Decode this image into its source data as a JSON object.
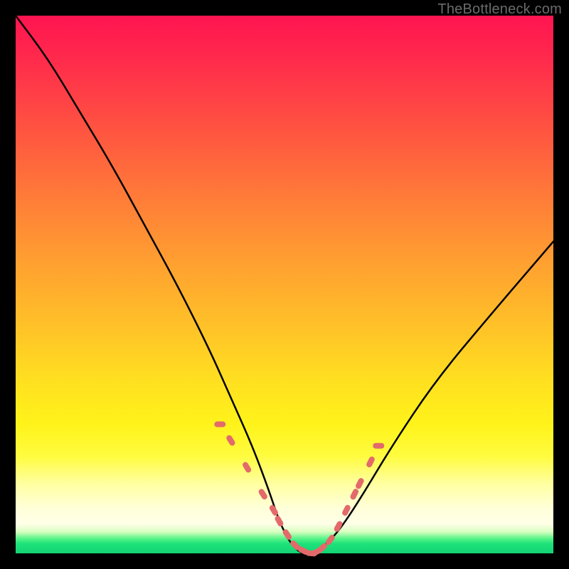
{
  "watermark": "TheBottleneck.com",
  "colors": {
    "frame": "#000000",
    "curve": "#000000",
    "marker": "#e36a6a",
    "gradient_top": "#ff1450",
    "gradient_mid": "#ffe020",
    "gradient_green": "#1de27a"
  },
  "chart_data": {
    "type": "line",
    "title": "",
    "xlabel": "",
    "ylabel": "",
    "xlim": [
      0,
      100
    ],
    "ylim": [
      0,
      100
    ],
    "grid": false,
    "legend": "none",
    "annotations": [
      "TheBottleneck.com"
    ],
    "series": [
      {
        "name": "bottleneck-curve",
        "x": [
          0,
          6,
          12,
          18,
          24,
          30,
          36,
          40,
          44,
          47,
          49,
          51,
          53,
          55,
          57,
          60,
          64,
          70,
          78,
          88,
          100
        ],
        "values": [
          100,
          92,
          82,
          72,
          61,
          50,
          38,
          29,
          20,
          12,
          6,
          2,
          0,
          0,
          1,
          4,
          10,
          20,
          32,
          44,
          58
        ]
      }
    ],
    "markers": {
      "name": "highlight-band",
      "x": [
        38,
        40,
        43,
        46,
        48,
        49,
        50.5,
        52,
        53.5,
        55,
        56,
        57,
        58.5,
        60,
        61.5,
        63,
        64,
        66,
        67.5
      ],
      "values": [
        24,
        21,
        16,
        11,
        8,
        6,
        3.5,
        1.5,
        0.5,
        0,
        0.3,
        1,
        2.5,
        5,
        8,
        11,
        13,
        17,
        20
      ]
    }
  }
}
